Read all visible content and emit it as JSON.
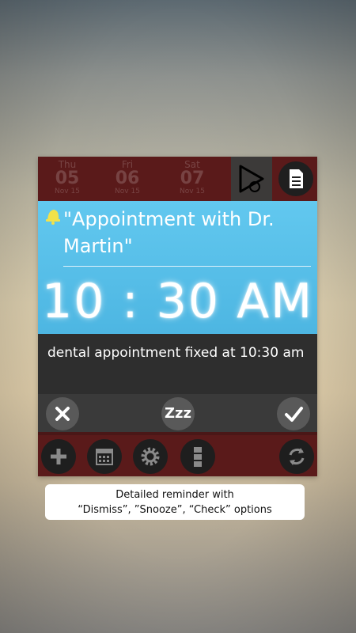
{
  "calendar": {
    "days": [
      {
        "dow": "Thu",
        "num": "05",
        "mon": "Nov 15"
      },
      {
        "dow": "Fri",
        "num": "06",
        "mon": "Nov 15"
      },
      {
        "dow": "Sat",
        "num": "07",
        "mon": "Nov 15"
      }
    ]
  },
  "reminder": {
    "title": "\"Appointment with Dr. Martin\"",
    "time": "10 : 30 AM",
    "description": "dental appointment fixed at 10:30 am"
  },
  "actions": {
    "snooze_label": "Zzz"
  },
  "icons": {
    "top": [
      "play-icon",
      "document-icon"
    ],
    "reminder": [
      "bell-icon"
    ],
    "actions": [
      "close-icon",
      "snooze-icon",
      "check-icon"
    ],
    "toolbar": [
      "plus-icon",
      "calendar-icon",
      "gear-icon",
      "list-icon",
      "sync-icon"
    ]
  },
  "colors": {
    "header_blue": "#4db6e2",
    "app_maroon": "#5a1a1a",
    "bell_yellow": "#f2e24a"
  },
  "caption": {
    "line1": "Detailed reminder with",
    "line2": "“Dismiss”, ”Snooze”, “Check” options"
  }
}
